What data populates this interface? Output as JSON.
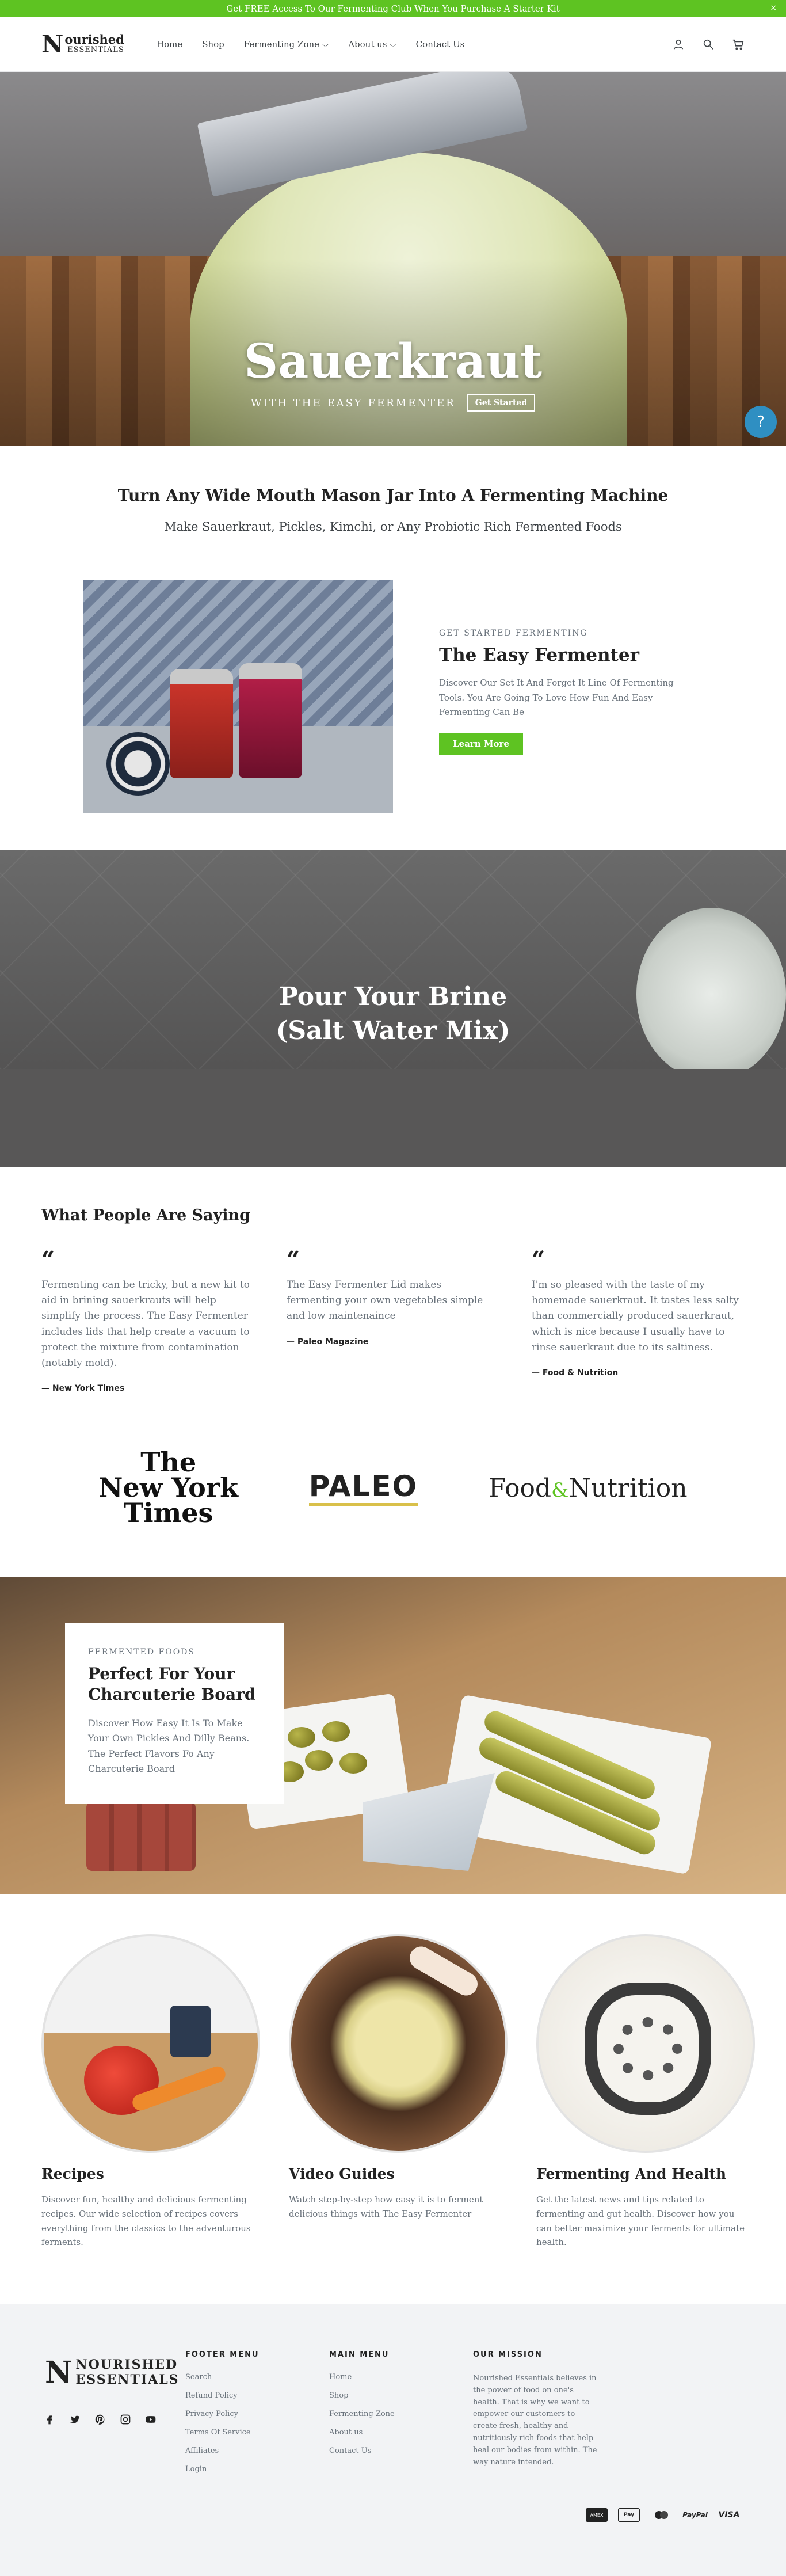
{
  "announcement": {
    "text": "Get FREE Access To Our Fermenting Club When You Purchase A Starter Kit",
    "close": "×"
  },
  "header": {
    "logo": {
      "initial": "N",
      "line1": "ourished",
      "line2": "ESSENTIALS"
    },
    "nav": [
      {
        "label": "Home"
      },
      {
        "label": "Shop"
      },
      {
        "label": "Fermenting Zone ⌵"
      },
      {
        "label": "About us ⌵"
      },
      {
        "label": "Contact Us"
      }
    ],
    "icons": [
      "account-icon",
      "search-icon",
      "cart-icon"
    ]
  },
  "hero": {
    "title": "Sauerkraut",
    "subtitle": "WITH THE EASY FERMENTER",
    "button": "Get Started"
  },
  "help_button": "?",
  "intro": {
    "title": "Turn Any Wide Mouth Mason Jar Into A Fermenting Machine",
    "subtitle": "Make Sauerkraut, Pickles, Kimchi, or Any Probiotic Rich Fermented Foods"
  },
  "feature": {
    "eyebrow": "GET STARTED FERMENTING",
    "title": "The Easy Fermenter",
    "description": "Discover Our Set It And Forget It Line Of Fermenting Tools. You Are Going To Love How Fun And Easy Fermenting Can Be",
    "button": "Learn More"
  },
  "video": {
    "line1": "Pour Your Brine",
    "line2": "(Salt Water Mix)"
  },
  "testimonials": {
    "title": "What People Are Saying",
    "items": [
      {
        "quote": "Fermenting can be tricky, but a new kit to aid in brining sauerkrauts will help simplify the process. The Easy Fermenter includes lids that help create a vacuum to protect the mixture from contamination (notably mold).",
        "source": "— New York Times"
      },
      {
        "quote": "The Easy Fermenter Lid makes fermenting your own vegetables simple and low maintenaince",
        "source": "— Paleo Magazine"
      },
      {
        "quote": "I'm so pleased with the taste of my homemade sauerkraut. It tastes less salty than commercially produced sauerkraut, which is nice because I usually have to rinse sauerkraut due to its saltiness.",
        "source": "— Food & Nutrition"
      }
    ]
  },
  "press_logos": {
    "nyt": [
      "The",
      "New York",
      "Times"
    ],
    "paleo": "PALEO",
    "fn": {
      "food": "Food",
      "amp": "&",
      "nutrition": "Nutrition"
    }
  },
  "charcuterie": {
    "eyebrow": "FERMENTED FOODS",
    "title": "Perfect For Your Charcuterie Board",
    "description": "Discover How Easy It Is To Make Your Own Pickles And Dilly Beans. The Perfect Flavors Fo Any Charcuterie Board"
  },
  "cards": [
    {
      "title": "Recipes",
      "text": "Discover fun, healthy and delicious fermenting recipes.  Our wide selection of recipes covers everything from the classics to the adventurous ferments."
    },
    {
      "title": "Video Guides",
      "text": "Watch step-by-step how easy it is to ferment delicious things with The Easy Fermenter"
    },
    {
      "title": "Fermenting And Health",
      "text": "Get the latest news and tips related to fermenting and gut health.  Discover how you can better maximize your ferments for ultimate health."
    }
  ],
  "footer": {
    "logo": {
      "initial": "N",
      "line1": "NOURISHED",
      "line2": "ESSENTIALS"
    },
    "social": [
      "facebook-icon",
      "twitter-icon",
      "pinterest-icon",
      "instagram-icon",
      "youtube-icon"
    ],
    "footer_menu": {
      "title": "FOOTER MENU",
      "items": [
        "Search",
        "Refund Policy",
        "Privacy Policy",
        "Terms Of Service",
        "Affiliates",
        "Login"
      ]
    },
    "main_menu": {
      "title": "MAIN MENU",
      "items": [
        "Home",
        "Shop",
        "Fermenting Zone",
        "About us",
        "Contact Us"
      ]
    },
    "mission": {
      "title": "OUR MISSION",
      "text": "Nourished Essentials believes in the power of food on one's health. That is why we want to empower our customers to create fresh, healthy and nutritiously rich foods that help heal our bodies from within.  The way nature intended."
    },
    "payments": [
      "AMEX",
      "Pay",
      "MC",
      "PayPal",
      "VISA"
    ]
  }
}
